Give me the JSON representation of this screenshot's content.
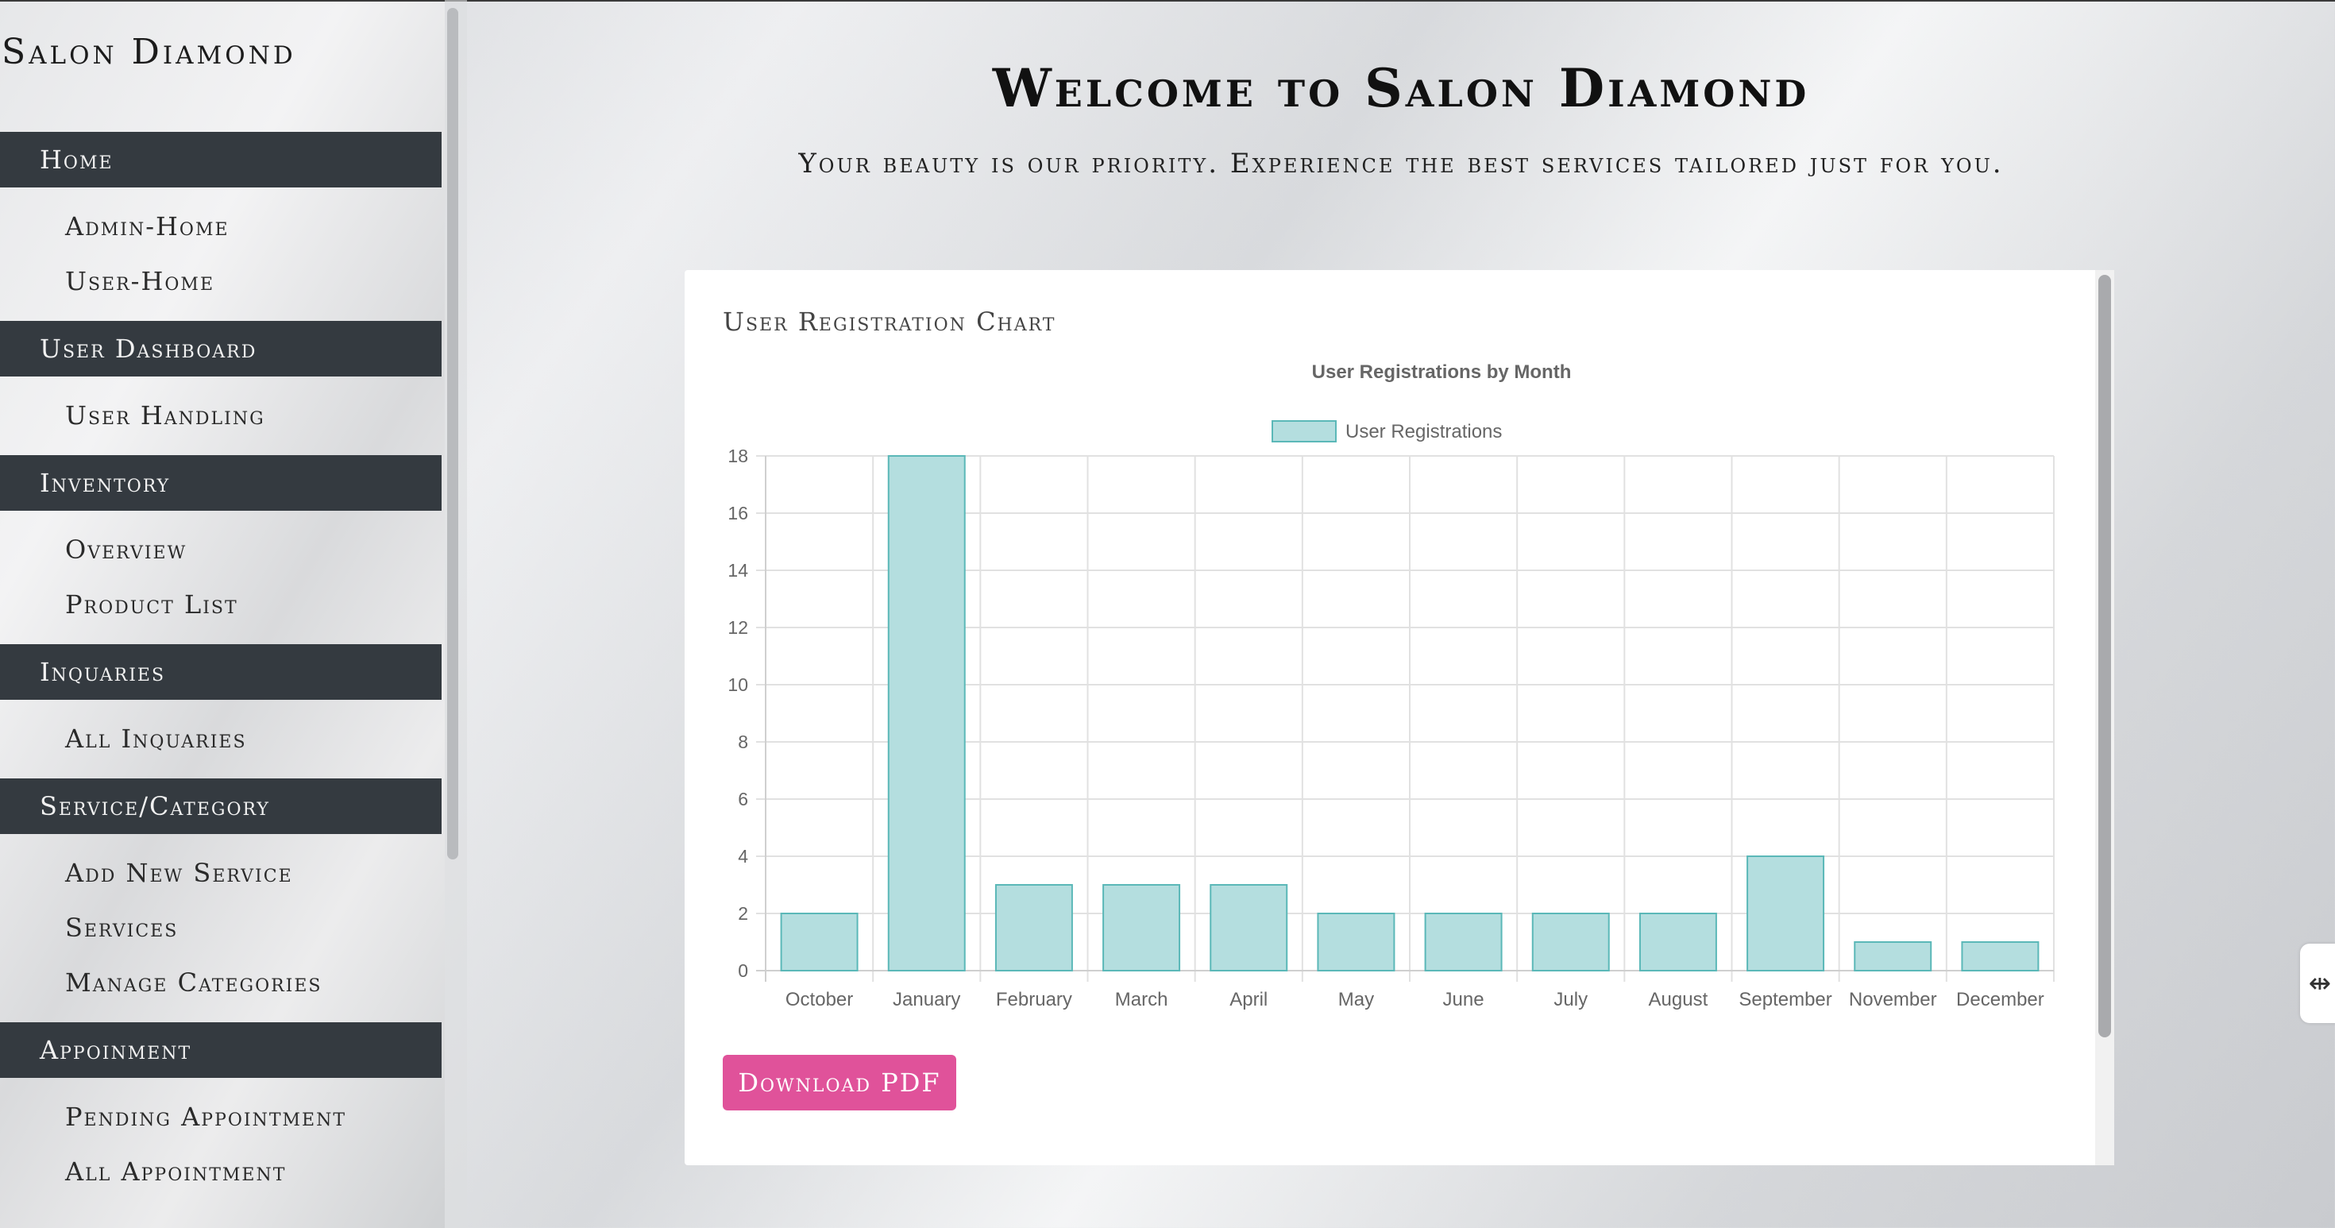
{
  "brand": "Salon Diamond",
  "header": {
    "welcome": "Welcome to Salon Diamond",
    "tagline": "Your beauty is our priority. Experience the best services tailored just for you."
  },
  "sidebar": {
    "sections": [
      {
        "label": "Home",
        "items": [
          "Admin-Home",
          "User-Home"
        ]
      },
      {
        "label": "User Dashboard",
        "items": [
          "User Handling"
        ]
      },
      {
        "label": "Inventory",
        "items": [
          "Overview",
          "Product List"
        ]
      },
      {
        "label": "Inquaries",
        "items": [
          "All Inquaries"
        ]
      },
      {
        "label": "Service/Category",
        "items": [
          "Add New Service",
          "Services",
          "Manage Categories"
        ]
      },
      {
        "label": "Appoinment",
        "items": [
          "Pending Appointment",
          "All Appointment"
        ]
      }
    ]
  },
  "card": {
    "title": "User Registration Chart",
    "download_label": "Download PDF"
  },
  "chart_data": {
    "type": "bar",
    "title": "User Registrations by Month",
    "categories": [
      "October",
      "January",
      "February",
      "March",
      "April",
      "May",
      "June",
      "July",
      "August",
      "September",
      "November",
      "December"
    ],
    "series": [
      {
        "name": "User Registrations",
        "values": [
          2,
          18,
          3,
          3,
          3,
          2,
          2,
          2,
          2,
          4,
          1,
          1
        ]
      }
    ],
    "ylim": [
      0,
      18
    ],
    "yticks": [
      0,
      2,
      4,
      6,
      8,
      10,
      12,
      14,
      16,
      18
    ],
    "grid": true,
    "legend": "top-center",
    "bar_fill": "#b4dedf",
    "bar_stroke": "#5bb8b8"
  },
  "colors": {
    "sidebar_header": "#343a40",
    "accent_button": "#e0529a"
  },
  "side_tab_icon": "panel-toggle-icon"
}
